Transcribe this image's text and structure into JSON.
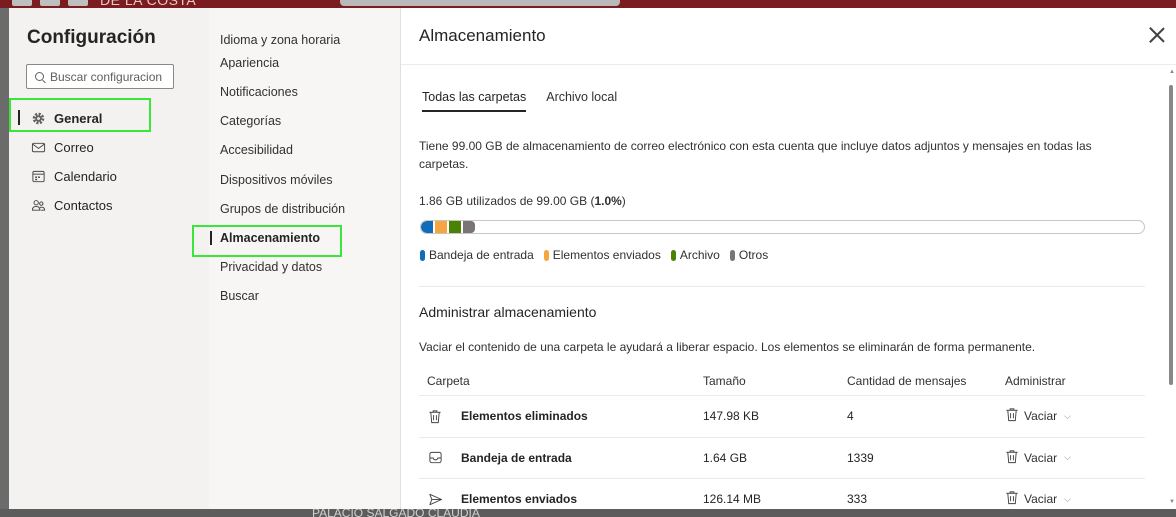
{
  "background": {
    "title_fragment": "DE LA COSTA",
    "bottom_fragment": "PALACIO SALGADO CLAUDIA"
  },
  "left": {
    "title": "Configuración",
    "search_placeholder": "Buscar configuracion",
    "items": [
      {
        "label": "General",
        "icon": "gear-icon",
        "active": true
      },
      {
        "label": "Correo",
        "icon": "mail-icon"
      },
      {
        "label": "Calendario",
        "icon": "calendar-icon"
      },
      {
        "label": "Contactos",
        "icon": "people-icon"
      }
    ]
  },
  "middle": {
    "items": [
      {
        "label": "Idioma y zona horaria"
      },
      {
        "label": "Apariencia"
      },
      {
        "label": "Notificaciones"
      },
      {
        "label": "Categorías"
      },
      {
        "label": "Accesibilidad"
      },
      {
        "label": "Dispositivos móviles"
      },
      {
        "label": "Grupos de distribución"
      },
      {
        "label": "Almacenamiento",
        "active": true
      },
      {
        "label": "Privacidad y datos"
      },
      {
        "label": "Buscar"
      }
    ]
  },
  "pane": {
    "title": "Almacenamiento",
    "tabs": [
      {
        "label": "Todas las carpetas",
        "active": true
      },
      {
        "label": "Archivo local"
      }
    ],
    "description": "Tiene 99.00 GB de almacenamiento de correo electrónico con esta cuenta que incluye datos adjuntos y mensajes en todas las carpetas.",
    "usage_prefix": "1.86 GB utilizados de 99.00 GB (",
    "usage_percent": "1.0%",
    "usage_suffix": ")",
    "usage_fraction": 0.01,
    "legend": [
      {
        "label": "Bandeja de entrada",
        "color": "#0f6cbd"
      },
      {
        "label": "Elementos enviados",
        "color": "#f7a540"
      },
      {
        "label": "Archivo",
        "color": "#498205"
      },
      {
        "label": "Otros",
        "color": "#7a7574"
      }
    ],
    "manage": {
      "title": "Administrar almacenamiento",
      "description": "Vaciar el contenido de una carpeta le ayudará a liberar espacio. Los elementos se eliminarán de forma permanente.",
      "columns": [
        "Carpeta",
        "Tamaño",
        "Cantidad de mensajes",
        "Administrar"
      ],
      "rows": [
        {
          "icon": "trash-icon",
          "folder": "Elementos eliminados",
          "size": "147.98 KB",
          "count": "4",
          "action": "Vaciar"
        },
        {
          "icon": "inbox-icon",
          "folder": "Bandeja de entrada",
          "size": "1.64 GB",
          "count": "1339",
          "action": "Vaciar"
        },
        {
          "icon": "send-icon",
          "folder": "Elementos enviados",
          "size": "126.14 MB",
          "count": "333",
          "action": "Vaciar"
        }
      ]
    }
  }
}
